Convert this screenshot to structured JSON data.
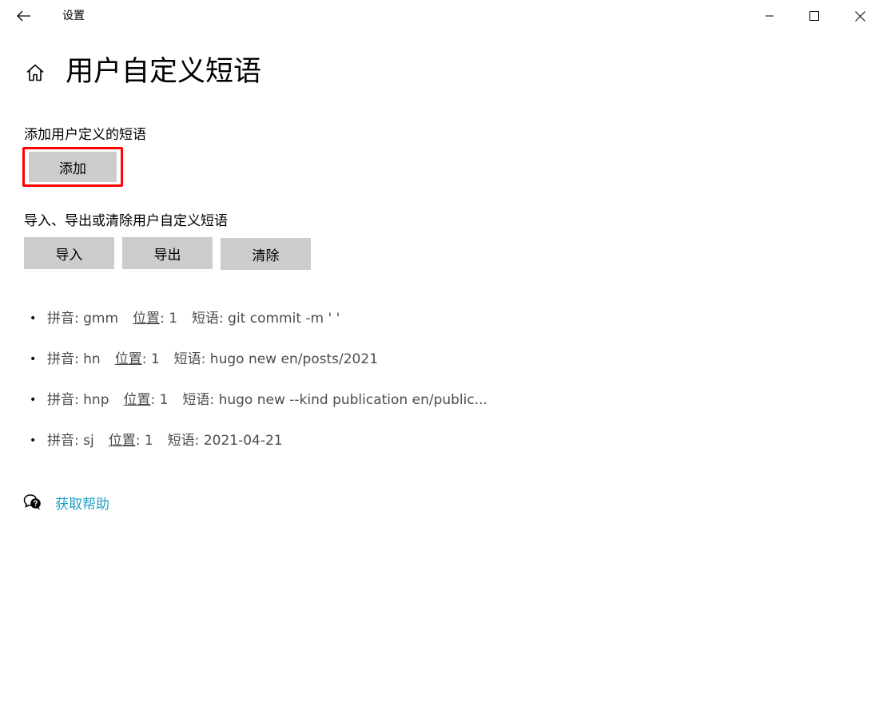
{
  "window": {
    "app_title": "设置",
    "back_icon": "back-arrow-icon",
    "controls": [
      "minimize-icon",
      "maximize-icon",
      "close-icon"
    ]
  },
  "header": {
    "home_icon": "home-icon",
    "title": "用户自定义短语"
  },
  "add_section": {
    "label": "添加用户定义的短语",
    "button": "添加",
    "highlight_color": "#ff0000"
  },
  "io_section": {
    "label": "导入、导出或清除用户自定义短语",
    "import_button": "导入",
    "export_button": "导出",
    "clear_button": "清除"
  },
  "phrases": [
    {
      "pinyin_label": "拼音:",
      "pinyin": "gmm",
      "position_label": "位置",
      "position": ": 1",
      "phrase_label": "短语:",
      "phrase": "git commit -m ' '"
    },
    {
      "pinyin_label": "拼音:",
      "pinyin": "hn",
      "position_label": "位置",
      "position": ": 1",
      "phrase_label": "短语:",
      "phrase": "hugo new en/posts/2021"
    },
    {
      "pinyin_label": "拼音:",
      "pinyin": "hnp",
      "position_label": "位置",
      "position": ": 1",
      "phrase_label": "短语:",
      "phrase": "hugo new --kind publication en/public..."
    },
    {
      "pinyin_label": "拼音:",
      "pinyin": "sj",
      "position_label": "位置",
      "position": ": 1",
      "phrase_label": "短语:",
      "phrase": "2021-04-21"
    }
  ],
  "help": {
    "icon": "help-chat-icon",
    "link": "获取帮助",
    "link_color": "#1f9fc3"
  }
}
